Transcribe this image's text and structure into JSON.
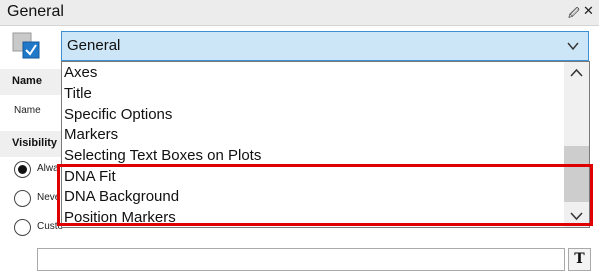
{
  "window": {
    "title": "General",
    "pin_icon": "pin-icon",
    "close_icon": "close-icon"
  },
  "combo": {
    "value": "General",
    "icon": "chevron-down-icon"
  },
  "page_icon": "page-checkbox-icon",
  "background": {
    "name_header": "Name",
    "name_label": "Name",
    "visibility_header": "Visibility",
    "radios": [
      {
        "label": "Alwa",
        "checked": true
      },
      {
        "label": "Neve",
        "checked": false
      },
      {
        "label": "Custo",
        "checked": false
      }
    ],
    "text_button": "T"
  },
  "dropdown": {
    "items": [
      "Axes",
      "Title",
      "Specific Options",
      "Markers",
      "Selecting Text Boxes on Plots",
      "DNA Fit",
      "DNA Background",
      "Position Markers"
    ],
    "scroll_up_icon": "chevron-up-icon",
    "scroll_down_icon": "chevron-down-icon"
  },
  "colors": {
    "combo_bg": "#cde6f7",
    "combo_border": "#3c8fd3",
    "highlight": "#e00000"
  }
}
